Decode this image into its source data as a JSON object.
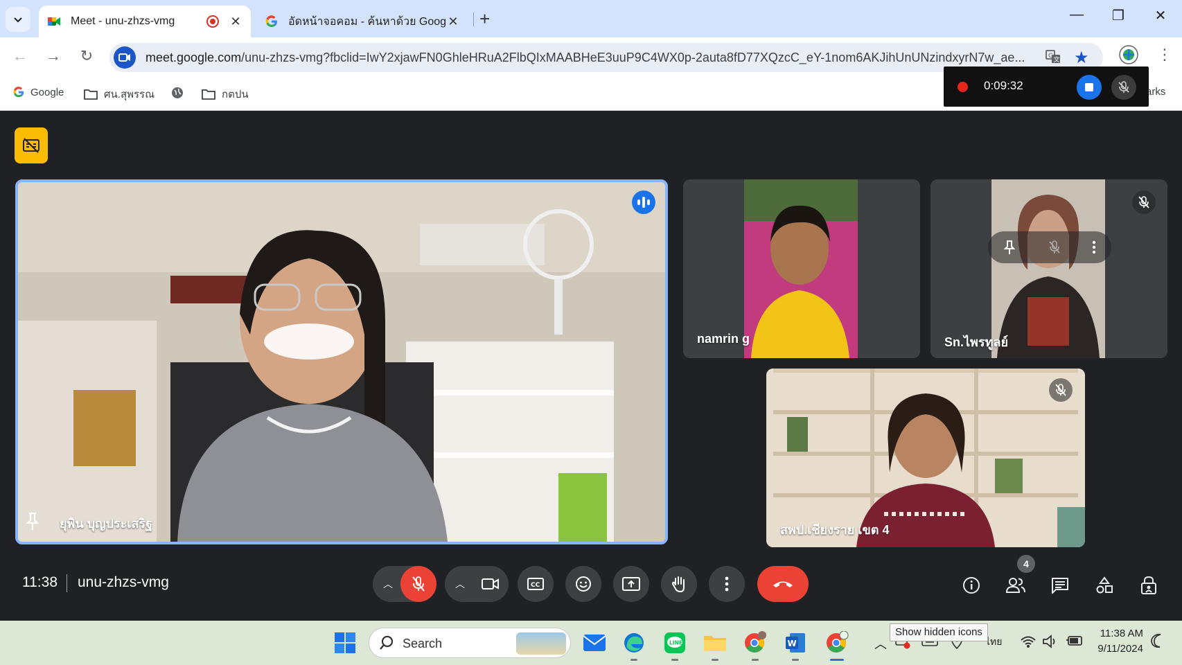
{
  "browser": {
    "tabs": [
      {
        "title": "Meet - unu-zhzs-vmg",
        "active": true
      },
      {
        "title": "อัดหน้าจอคอม - ค้นหาด้วย Google",
        "active": false
      }
    ],
    "url_host": "meet.google.com",
    "url_path": "/unu-zhzs-vmg?fbclid=IwY2xjawFN0GhleHRuA2FlbQIxMAABHeE3uuP9C4WX0p-2auta8fD77XQzcC_eY-1nom6AKJihUnUNzindxyrN7w_ae...",
    "bookmarks": [
      {
        "label": "Google",
        "icon": "google-icon"
      },
      {
        "label": "ศน.สุพรรณ",
        "icon": "folder-icon"
      },
      {
        "label": "",
        "icon": "globe-icon"
      },
      {
        "label": "กตปน",
        "icon": "folder-icon"
      }
    ],
    "bookmarks_overflow": "arks"
  },
  "recording": {
    "elapsed": "0:09:32"
  },
  "meet": {
    "time": "11:38",
    "code": "unu-zhzs-vmg",
    "participant_count": "4",
    "participants": [
      {
        "name": "ยุพิน บุญประเสริฐ",
        "state": "speaking"
      },
      {
        "name": "namrin g",
        "state": "unmuted"
      },
      {
        "name": "Sn.ไพรทูลย์",
        "state": "muted"
      },
      {
        "name": "สพป.เชียงราย เขต 4",
        "state": "muted"
      }
    ]
  },
  "taskbar": {
    "search_label": "Search",
    "tooltip": "Show hidden icons",
    "language": "ไทย",
    "clock_time": "11:38 AM",
    "clock_date": "9/11/2024"
  },
  "colors": {
    "meet_bg": "#202124",
    "control_bg": "#3c4043",
    "danger": "#ea4335",
    "accent": "#1a73e8",
    "speaking_border": "#8ab4f8",
    "caption_badge": "#fbbc04"
  }
}
